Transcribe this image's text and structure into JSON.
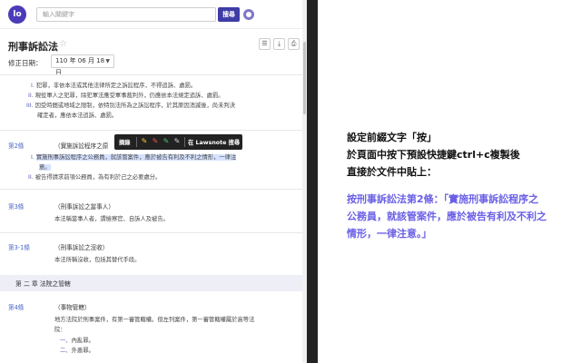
{
  "app": {
    "logo_text": "lo",
    "search_placeholder": "輸入關鍵字",
    "search_button": "搜尋",
    "title": "刑事訴訟法",
    "tools": [
      "☰",
      "⤓",
      "⎙"
    ],
    "date_label": "修正日期：",
    "date_value": "110 年 06 月 18 日",
    "top_items": [
      {
        "num": "I.",
        "text": "犯罪，非依本法或其他法律所定之訴訟程序，不得追訴、處罰。"
      },
      {
        "num": "II.",
        "text": "現役軍人之犯罪，除犯軍法應受軍事裁判外，仍應依本法規定追訴、處罰。"
      },
      {
        "num": "III.",
        "text": "因受時間或地域之限制，依特別法所為之訴訟程序，於其原因消滅後，尚未判決"
      },
      {
        "num": "",
        "text": "確定者，應依本法追訴、處罰。"
      }
    ],
    "articles": [
      {
        "no": "第2條",
        "heading": "（實施訴訟程序之原",
        "items": [
          {
            "num": "I.",
            "text": "實施刑事訴訟程序之公務員，就該管案件，應於被告有利及不利之情形，一律注",
            "highlight": true
          },
          {
            "num": "",
            "text": "意。",
            "highlight": true
          },
          {
            "num": "II.",
            "text": "被告得請求前項公務員，為有利於己之必要處分。",
            "highlight": false
          }
        ]
      },
      {
        "no": "第3條",
        "heading": "（刑事訴訟之當事人）",
        "body": "本法稱當事人者，謂檢察官、自訴人及被告。"
      },
      {
        "no": "第3-1條",
        "heading": "（刑事訴訟之沒收）",
        "body": "本法所稱沒收，包括其替代手段。"
      },
      {
        "no": "第4條",
        "heading": "（事物管轄）",
        "body": "地方法院於刑事案件，有第一審管轄權。但左列案件，第一審管轄權屬於高等法",
        "body2": "院：",
        "sub": [
          {
            "num": "一、",
            "text": "內亂罪。"
          },
          {
            "num": "二、",
            "text": "外患罪。"
          }
        ]
      }
    ],
    "chapter": "第 二 章 法院之管轄",
    "tooltip": {
      "excerpt": "摘錄",
      "lawsnote": "在 Lawsnote 搜尋"
    },
    "pen_colors": [
      "#f2d13a",
      "#e85555",
      "#4fc36a",
      "#d8d8d8"
    ]
  },
  "note": {
    "lines": [
      "設定前綴文字「按」",
      "於頁面中按下預設快捷鍵ctrl+c複製後",
      "直接於文件中貼上："
    ],
    "quote": [
      "按刑事訴訟法第2條：「實施刑事訴訟程序之",
      "公務員，就該管案件，應於被告有利及不利之",
      "情形，一律注意。」"
    ]
  },
  "colors": {
    "accent": "#3e3ca6",
    "quote": "#6a60e6",
    "link": "#4a66c8",
    "highlight": "#d6e2ff"
  }
}
